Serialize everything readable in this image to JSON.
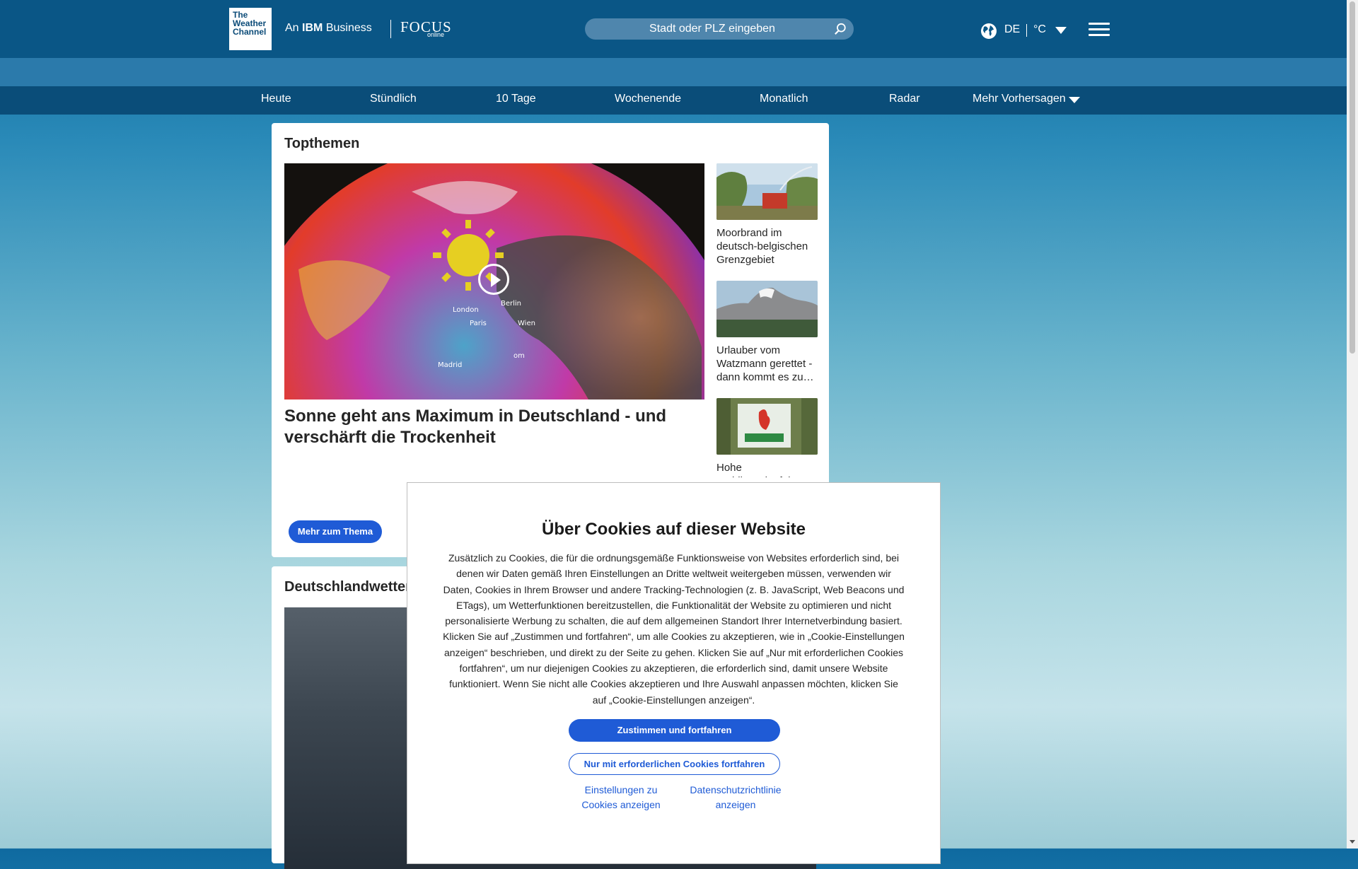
{
  "header": {
    "logo_lines": [
      "The",
      "Weather",
      "Channel"
    ],
    "ibm_prefix": "An",
    "ibm_brand": "IBM",
    "ibm_suffix": "Business",
    "partner_logo": "FOCUS",
    "partner_logo_sub": "online",
    "search_placeholder": "Stadt oder PLZ eingeben",
    "language": "DE",
    "unit": "°C"
  },
  "nav": {
    "items": [
      "Heute",
      "Stündlich",
      "10 Tage",
      "Wochenende",
      "Monatlich",
      "Radar",
      "Mehr Vorhersagen"
    ]
  },
  "top_stories": {
    "title": "Topthemen",
    "main_headline": "Sonne geht ans Maximum in Deutschland - und verschärft die Trockenheit",
    "more_button": "Mehr zum Thema",
    "map_labels": [
      "London",
      "Berlin",
      "Paris",
      "Wien",
      "Madrid",
      "om"
    ],
    "side_stories": [
      {
        "caption": "Moorbrand im deutsch-belgischen Grenzgebiet"
      },
      {
        "caption": "Urlauber vom Watzmann gerettet - dann kommt es zu…"
      },
      {
        "caption": "Hohe Waldbrandgefahr:"
      }
    ]
  },
  "germany_weather": {
    "title": "Deutschlandwetter"
  },
  "cookie_modal": {
    "title": "Über Cookies auf dieser Website",
    "body": "Zusätzlich zu Cookies, die für die ordnungsgemäße Funktionsweise von Websites erforderlich sind, bei denen wir Daten gemäß Ihren Einstellungen an Dritte weltweit weitergeben müssen, verwenden wir Daten, Cookies in Ihrem Browser und andere Tracking-Technologien (z. B. JavaScript, Web Beacons und ETags), um Wetterfunktionen bereitzustellen, die Funktionalität der Website zu optimieren und nicht personalisierte Werbung zu schalten, die auf dem allgemeinen Standort Ihrer Internetverbindung basiert. Klicken Sie auf „Zustimmen und fortfahren“, um alle Cookies zu akzeptieren, wie in „Cookie-Einstellungen anzeigen“ beschrieben, und direkt zu der Seite zu gehen. Klicken Sie auf „Nur mit erforderlichen Cookies fortfahren“, um nur diejenigen Cookies zu akzeptieren, die erforderlich sind, damit unsere Website funktioniert. Wenn Sie nicht alle Cookies akzeptieren und Ihre Auswahl anpassen möchten, klicken Sie auf „Cookie-Einstellungen anzeigen“.",
    "accept_button": "Zustimmen und fortfahren",
    "necessary_button": "Nur mit erforderlichen Cookies fortfahren",
    "settings_link": "Einstellungen zu Cookies anzeigen",
    "privacy_link": "Datenschutzrichtlinie anzeigen"
  },
  "colors": {
    "header_bg": "#0a5686",
    "nav_bg": "#0a4d79",
    "primary_button": "#1f5bd6"
  }
}
